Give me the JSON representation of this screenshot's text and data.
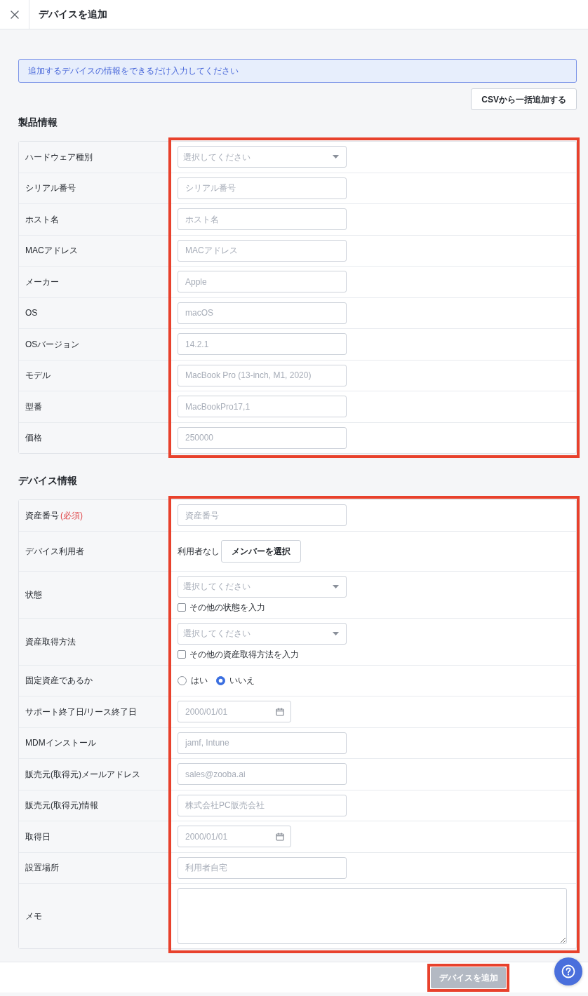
{
  "header": {
    "title": "デバイスを追加"
  },
  "notice": {
    "text": "追加するデバイスの情報をできるだけ入力してください"
  },
  "csv_button": {
    "label": "CSVから一括追加する"
  },
  "sections": [
    {
      "title": "製品情報",
      "highlighted": true,
      "rows": [
        {
          "label": "ハードウェア種別",
          "kind": "select",
          "placeholder": "選択してください"
        },
        {
          "label": "シリアル番号",
          "kind": "text",
          "placeholder": "シリアル番号"
        },
        {
          "label": "ホスト名",
          "kind": "text",
          "placeholder": "ホスト名"
        },
        {
          "label": "MACアドレス",
          "kind": "text",
          "placeholder": "MACアドレス"
        },
        {
          "label": "メーカー",
          "kind": "text",
          "placeholder": "Apple"
        },
        {
          "label": "OS",
          "kind": "text",
          "placeholder": "macOS"
        },
        {
          "label": "OSバージョン",
          "kind": "text",
          "placeholder": "14.2.1"
        },
        {
          "label": "モデル",
          "kind": "text",
          "placeholder": "MacBook Pro (13-inch, M1, 2020)"
        },
        {
          "label": "型番",
          "kind": "text",
          "placeholder": "MacBookPro17,1"
        },
        {
          "label": "価格",
          "kind": "text",
          "placeholder": "250000"
        }
      ]
    },
    {
      "title": "デバイス情報",
      "highlighted": true,
      "rows": [
        {
          "label": "資産番号",
          "required_mark": "(必須)",
          "kind": "text",
          "placeholder": "資産番号"
        },
        {
          "label": "デバイス利用者",
          "kind": "member",
          "status_text": "利用者なし",
          "button": "メンバーを選択"
        },
        {
          "label": "状態",
          "kind": "select",
          "placeholder": "選択してください",
          "checkbox": {
            "label": "その他の状態を入力",
            "checked": false
          }
        },
        {
          "label": "資産取得方法",
          "kind": "select",
          "placeholder": "選択してください",
          "checkbox": {
            "label": "その他の資産取得方法を入力",
            "checked": false
          }
        },
        {
          "label": "固定資産であるか",
          "kind": "radio",
          "options": [
            {
              "label": "はい",
              "selected": false
            },
            {
              "label": "いいえ",
              "selected": true
            }
          ]
        },
        {
          "label": "サポート終了日/リース終了日",
          "kind": "date",
          "placeholder": "2000/01/01"
        },
        {
          "label": "MDMインストール",
          "kind": "text",
          "placeholder": "jamf, Intune"
        },
        {
          "label": "販売元(取得元)メールアドレス",
          "kind": "text",
          "placeholder": "sales@zooba.ai"
        },
        {
          "label": "販売元(取得元)情報",
          "kind": "text",
          "placeholder": "株式会社PC販売会社"
        },
        {
          "label": "取得日",
          "kind": "date",
          "placeholder": "2000/01/01"
        },
        {
          "label": "設置場所",
          "kind": "text",
          "placeholder": "利用者自宅"
        },
        {
          "label": "メモ",
          "kind": "textarea"
        }
      ]
    }
  ],
  "footer": {
    "submit_button": {
      "label": "デバイスを追加",
      "disabled": true,
      "highlighted": true
    }
  }
}
